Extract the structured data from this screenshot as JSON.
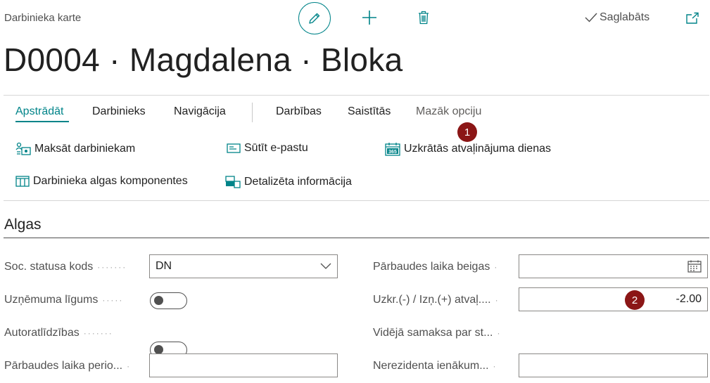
{
  "header": {
    "page_type": "Darbinieka karte",
    "title": "D0004 · Magdalena · Bloka",
    "saved_label": "Saglabāts"
  },
  "tabs": [
    {
      "label": "Apstrādāt",
      "active": true
    },
    {
      "label": "Darbinieks"
    },
    {
      "label": "Navigācija"
    },
    {
      "label": "Darbības"
    },
    {
      "label": "Saistītās"
    },
    {
      "label": "Mazāk opciju"
    }
  ],
  "actions": [
    {
      "label": "Maksāt darbiniekam",
      "icon": "pay-employee-icon"
    },
    {
      "label": "Sūtīt e-pastu",
      "icon": "email-icon"
    },
    {
      "label": "Uzkrātās atvaļinājuma dienas",
      "icon": "calendar-365-icon"
    },
    {
      "label": "Darbinieka algas komponentes",
      "icon": "table-columns-icon"
    },
    {
      "label": "Detalizēta informācija",
      "icon": "details-icon"
    }
  ],
  "badges": [
    "1",
    "2"
  ],
  "section": {
    "title": "Algas"
  },
  "fields": {
    "soc_status": {
      "label": "Soc. statusa kods",
      "value": "DN"
    },
    "contract": {
      "label": "Uzņēmuma līgums",
      "on": false
    },
    "royalties": {
      "label": "Autoratlīdzības",
      "on": false
    },
    "probation_period": {
      "label": "Pārbaudes laika perio...",
      "value": ""
    },
    "probation_end": {
      "label": "Pārbaudes laika beigas",
      "value": ""
    },
    "vacation_days": {
      "label": "Uzkr.(-) / Izņ.(+) atvaļ....",
      "value": "-2.00"
    },
    "avg_pay": {
      "label": "Vidējā samaksa par st...",
      "on": false
    },
    "nonresident": {
      "label": "Nerezidenta ienākum...",
      "value": ""
    }
  },
  "colors": {
    "accent": "#008489",
    "badge": "#8b1616"
  }
}
